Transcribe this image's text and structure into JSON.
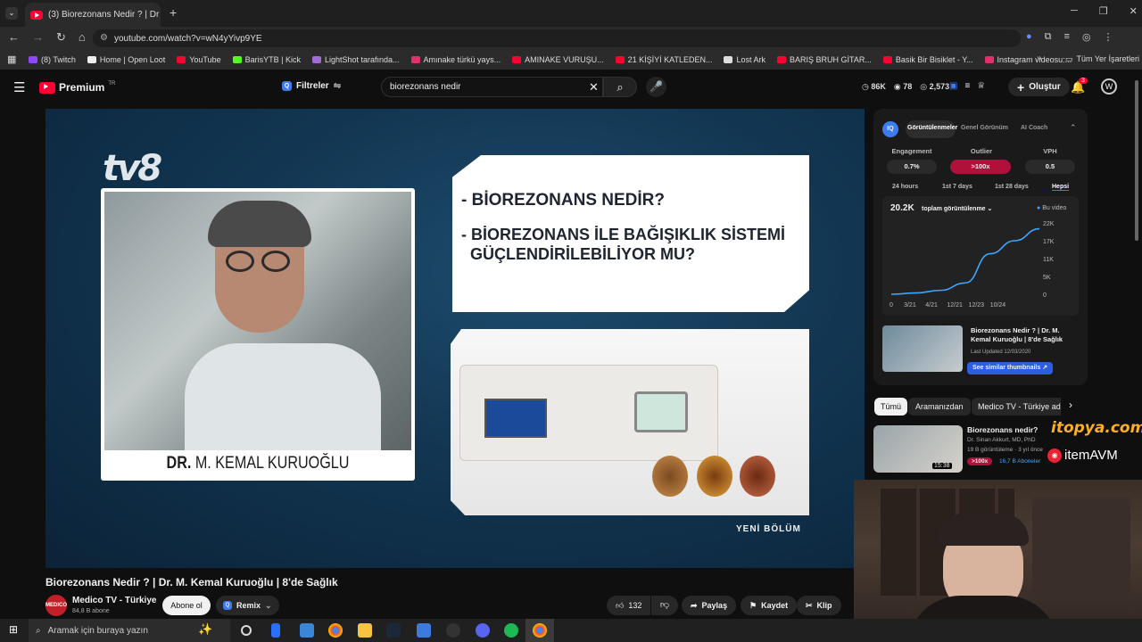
{
  "browser": {
    "tab_title": "(3) Biorezonans Nedir ? | Dr",
    "url": "youtube.com/watch?v=wN4yYivp9YE",
    "bookmarks": [
      {
        "label": "(8) Twitch",
        "color": "#9146ff"
      },
      {
        "label": "Home | Open Loot",
        "color": "#eeeeee"
      },
      {
        "label": "YouTube",
        "color": "#ff0033"
      },
      {
        "label": "BarisYTB | Kick",
        "color": "#53fc18"
      },
      {
        "label": "LightShot tarafında...",
        "color": "#a06cd5"
      },
      {
        "label": "Amınake türkü yays...",
        "color": "#e1306c"
      },
      {
        "label": "AMINAKE VURUŞU...",
        "color": "#ff0033"
      },
      {
        "label": "21 KİŞİYİ KATLEDEN...",
        "color": "#ff0033"
      },
      {
        "label": "Lost Ark",
        "color": "#dddddd"
      },
      {
        "label": "BARIŞ BRUH GİTAR...",
        "color": "#ff0033"
      },
      {
        "label": "Basik Bir Bisiklet - Y...",
        "color": "#ff0033"
      },
      {
        "label": "Instagram videosu:...",
        "color": "#e1306c"
      }
    ],
    "all_bookmarks": "Tüm Yer İşaretleri"
  },
  "header": {
    "logo_text": "Premium",
    "logo_sup": "TR",
    "filters": "Filtreler",
    "search_value": "biorezonans nedir",
    "stats": [
      "86K",
      "78",
      "2,573"
    ],
    "create": "Oluştur",
    "notif_count": "3"
  },
  "video": {
    "channel_logo": "tv8",
    "q1": "- BİOREZONANS NEDİR?",
    "q2a": "- BİOREZONANS İLE BAĞIŞIKLIK SİSTEMİ",
    "q2b": "GÜÇLENDİRİLEBİLİYOR MU?",
    "name_bold": "DR.",
    "name_rest": " M. KEMAL KURUOĞLU",
    "badge": "YENİ BÖLÜM"
  },
  "below": {
    "title": "Biorezonans Nedir ? | Dr. M. Kemal Kuruoğlu | 8'de Sağlık",
    "channel": "Medico TV - Türkiye",
    "subs": "84,8 B abone",
    "subscribe": "Abone ol",
    "remix": "Remix",
    "likes": "132",
    "share": "Paylaş",
    "save": "Kaydet",
    "clip": "Klip"
  },
  "vidiq": {
    "tabs": [
      "Görüntülenmeler",
      "Genel Görünüm",
      "AI Coach"
    ],
    "labels": [
      "Engagement",
      "Outlier",
      "VPH"
    ],
    "values": [
      "0.7%",
      ">100x",
      "0.5"
    ],
    "ranges": [
      "24 hours",
      "1st 7 days",
      "1st 28 days",
      "Hepsi"
    ],
    "views": "20.2K",
    "views_label": "toplam görüntülenme",
    "legend": "Bu video",
    "y_ticks": [
      "22K",
      "17K",
      "11K",
      "5K",
      "0"
    ],
    "x_ticks": [
      "0",
      "3/21",
      "4/21",
      "12/21",
      "12/23",
      "10/24"
    ],
    "thumb_title": "Biorezonans Nedir ? | Dr. M. Kemal Kuruoğlu | 8'de Sağlık",
    "updated": "Last Updated 12/03/2020",
    "similar": "See similar thumbnails"
  },
  "chart_data": {
    "type": "line",
    "x": [
      "0",
      "3/21",
      "4/21",
      "12/21",
      "12/23",
      "10/24"
    ],
    "series": [
      {
        "name": "Bu video",
        "values": [
          0,
          400,
          1200,
          3500,
          12500,
          16500,
          20200
        ]
      }
    ],
    "ylim": [
      0,
      22000
    ]
  },
  "chips": [
    "Tümü",
    "Aramanızdan",
    "Medico TV - Türkiye adl"
  ],
  "rec": {
    "title": "Biorezonans nedir?",
    "channel": "Dr. Sinan Akkurt, MD, PhD",
    "meta": "19 B görüntüleme · 3 yıl önce",
    "badge": ">100x",
    "duration": "15:38",
    "sub_badge": "16,7 B Aboneler"
  },
  "overlay": {
    "brand1": "itopya.com",
    "brand2": "itemAVM"
  },
  "taskbar": {
    "search": "Aramak için buraya yazın"
  }
}
